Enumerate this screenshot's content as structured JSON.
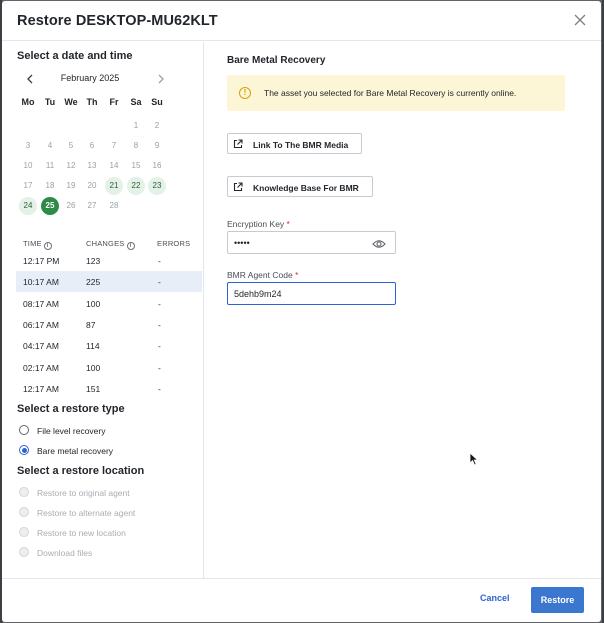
{
  "dialog": {
    "title": "Restore DESKTOP-MU62KLT"
  },
  "date_section": {
    "heading": "Select a date and time",
    "month_label": "February 2025",
    "weekdays": [
      "Mo",
      "Tu",
      "We",
      "Th",
      "Fr",
      "Sa",
      "Su"
    ],
    "weeks": [
      [
        "",
        "",
        "",
        "",
        "",
        "1",
        "2"
      ],
      [
        "3",
        "4",
        "5",
        "6",
        "7",
        "8",
        "9"
      ],
      [
        "10",
        "11",
        "12",
        "13",
        "14",
        "15",
        "16"
      ],
      [
        "17",
        "18",
        "19",
        "20",
        "21",
        "22",
        "23"
      ],
      [
        "24",
        "25",
        "26",
        "27",
        "28",
        "",
        ""
      ]
    ],
    "available_days": [
      "21",
      "22",
      "23",
      "24"
    ],
    "selected_day": "25"
  },
  "snapshots": {
    "headers": {
      "time": "TIME",
      "changes": "CHANGES",
      "errors": "ERRORS"
    },
    "rows": [
      {
        "time": "12:17 PM",
        "changes": "123",
        "errors": "-"
      },
      {
        "time": "10:17 AM",
        "changes": "225",
        "errors": "-"
      },
      {
        "time": "08:17 AM",
        "changes": "100",
        "errors": "-"
      },
      {
        "time": "06:17 AM",
        "changes": "87",
        "errors": "-"
      },
      {
        "time": "04:17 AM",
        "changes": "114",
        "errors": "-"
      },
      {
        "time": "02:17 AM",
        "changes": "100",
        "errors": "-"
      },
      {
        "time": "12:17 AM",
        "changes": "151",
        "errors": "-"
      }
    ],
    "selected_index": 1
  },
  "restore_type": {
    "heading": "Select a restore type",
    "options": [
      "File level recovery",
      "Bare metal recovery"
    ],
    "selected": "Bare metal recovery"
  },
  "restore_location": {
    "heading": "Select a restore location",
    "options": [
      "Restore to original agent",
      "Restore to alternate agent",
      "Restore to new location",
      "Download files"
    ]
  },
  "bmr": {
    "title": "Bare Metal Recovery",
    "alert_text": "The asset you selected for Bare Metal Recovery is currently online.",
    "link_media_label": "Link To The BMR Media",
    "knowledge_base_label": "Knowledge Base For BMR",
    "encryption_key_label": "Encryption Key",
    "encryption_key_value": "•••••",
    "agent_code_label": "BMR Agent Code",
    "agent_code_value": "5dehb9m24",
    "required_mark": "*"
  },
  "footer": {
    "cancel_label": "Cancel",
    "restore_label": "Restore"
  },
  "colors": {
    "accent": "#2b63d3",
    "available_day": "#e3f1e6",
    "selected_day": "#2e8b45",
    "alert_bg": "#fdf6d6",
    "primary_button": "#3b76cf"
  }
}
